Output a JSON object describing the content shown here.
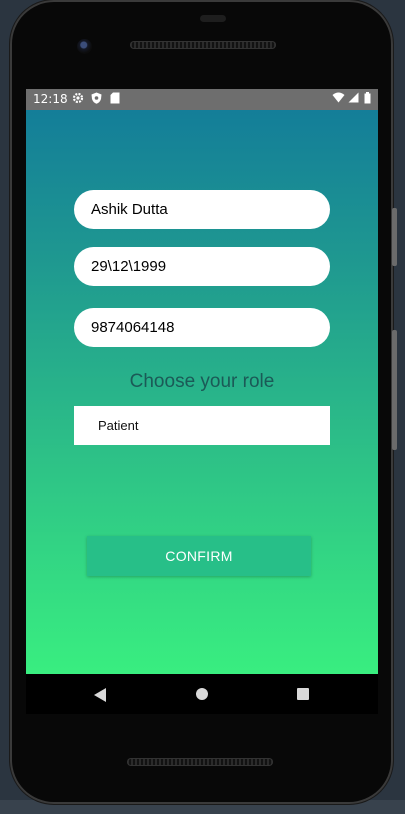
{
  "status_bar": {
    "time": "12:18",
    "left_icons": [
      "settings-gear-icon",
      "shield-icon",
      "sd-card-icon"
    ],
    "right_icons": [
      "wifi-icon",
      "signal-icon",
      "battery-icon"
    ]
  },
  "form": {
    "name_value": "Ashik Dutta",
    "dob_value": "29\\12\\1999",
    "phone_value": "9874064148",
    "role_label": "Choose your role",
    "role_selected": "Patient",
    "confirm_label": "CONFIRM"
  },
  "nav_bar": {
    "buttons": [
      "back-icon",
      "home-icon",
      "recents-icon"
    ]
  },
  "colors": {
    "gradient_top": "#127a9a",
    "gradient_bottom": "#39ee80",
    "confirm_button": "#27bf88",
    "role_label_text": "#1b5a57"
  }
}
